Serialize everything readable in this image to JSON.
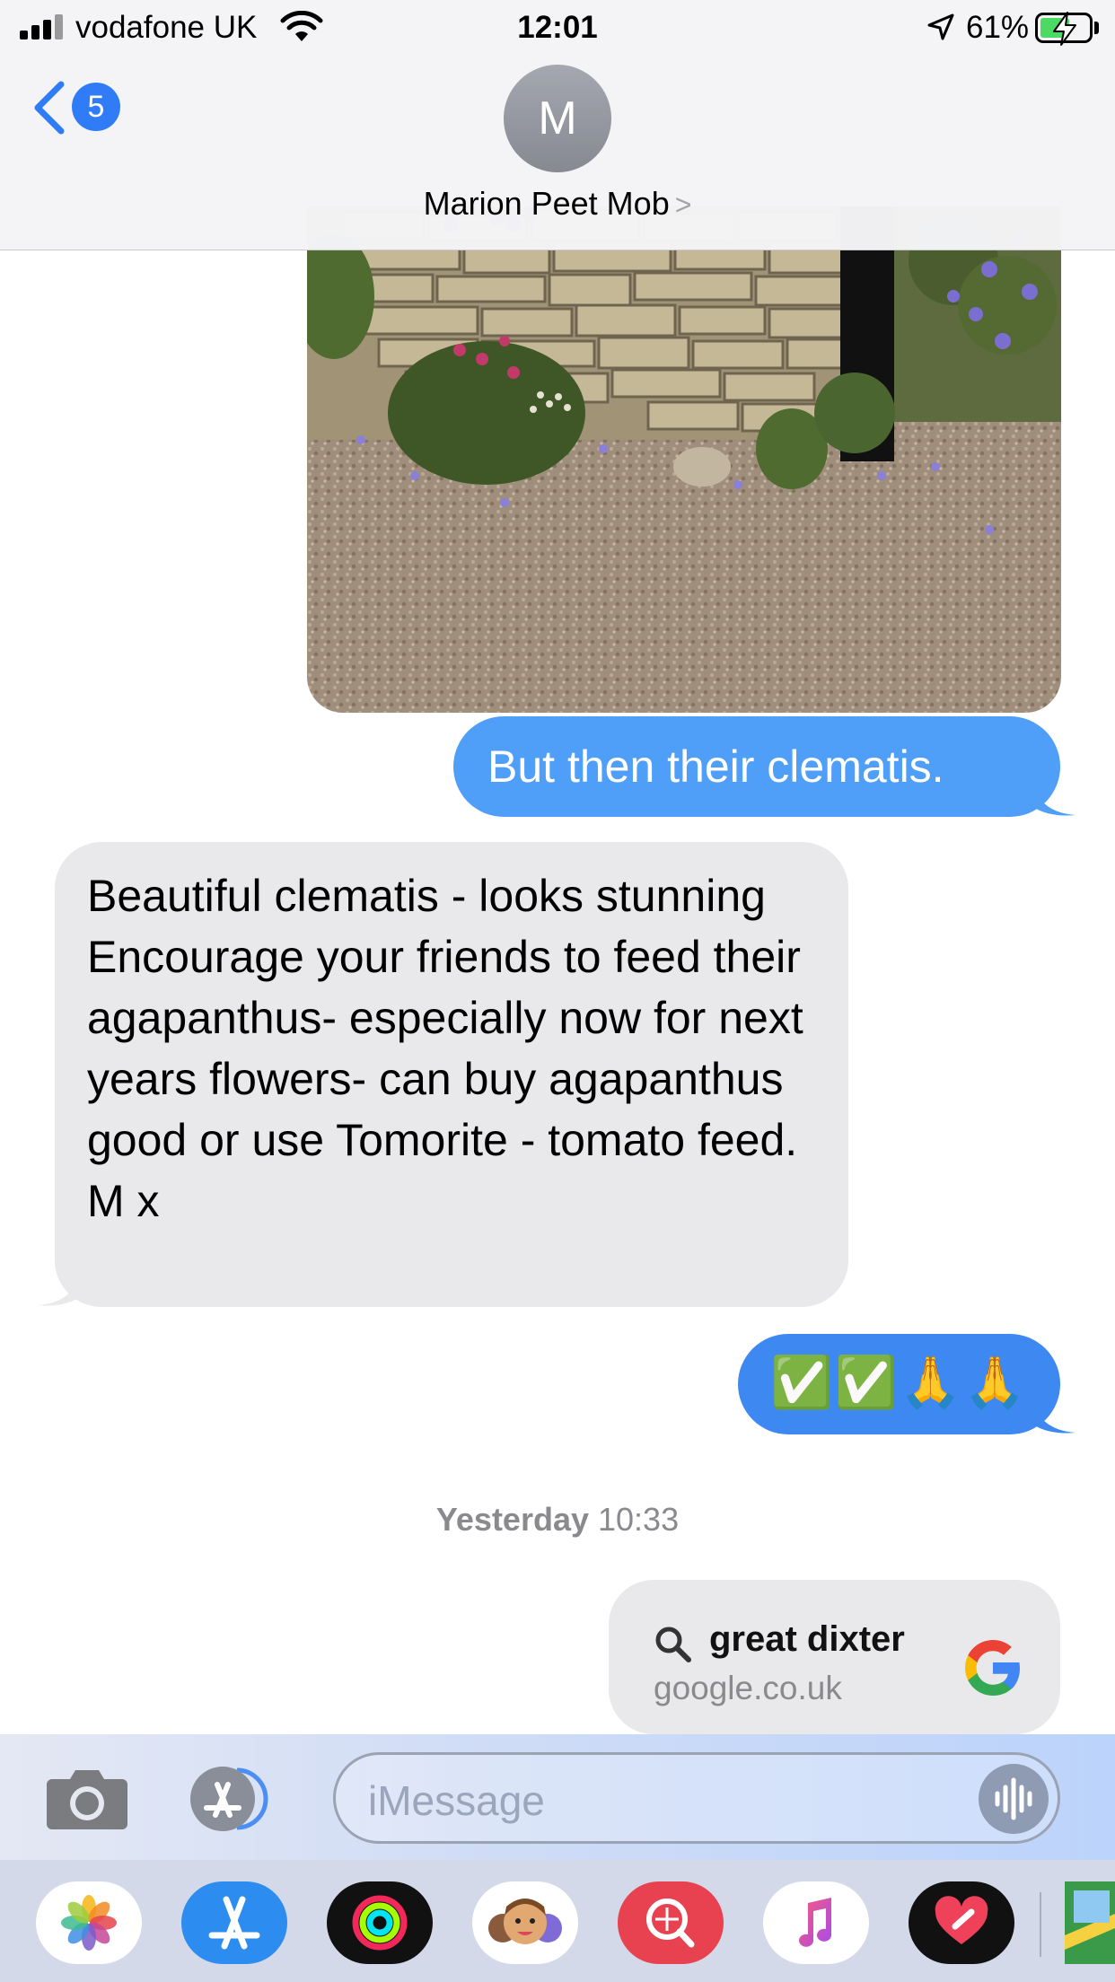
{
  "status_bar": {
    "carrier": "vodafone UK",
    "time": "12:01",
    "battery_percent": "61%",
    "battery_level": 0.61
  },
  "header": {
    "back_badge_count": "5",
    "avatar_initial": "M",
    "contact_name": "Marion Peet Mob",
    "contact_chevron": ">"
  },
  "messages": {
    "outgoing_1": "But then their clematis.",
    "incoming_1": "Beautiful clematis - looks stunning\nEncourage your friends to feed their agapanthus- especially now for next years flowers- can buy agapanthus good or use Tomorite - tomato feed. M x",
    "outgoing_2": "✅✅🙏🙏"
  },
  "timestamp": {
    "day": "Yesterday",
    "time": "10:33"
  },
  "link_preview": {
    "title": "great dixter",
    "domain": "google.co.uk"
  },
  "input": {
    "placeholder": "iMessage"
  },
  "app_drawer": {
    "apps": [
      "photos-icon",
      "app-store-icon",
      "activity-icon",
      "memoji-icon",
      "images-search-icon",
      "music-icon",
      "digital-touch-icon",
      "maps-icon"
    ]
  },
  "colors": {
    "outgoing_bubble": "#4f9ef7",
    "incoming_bubble": "#e9e9eb",
    "accent": "#2f7cf6"
  }
}
